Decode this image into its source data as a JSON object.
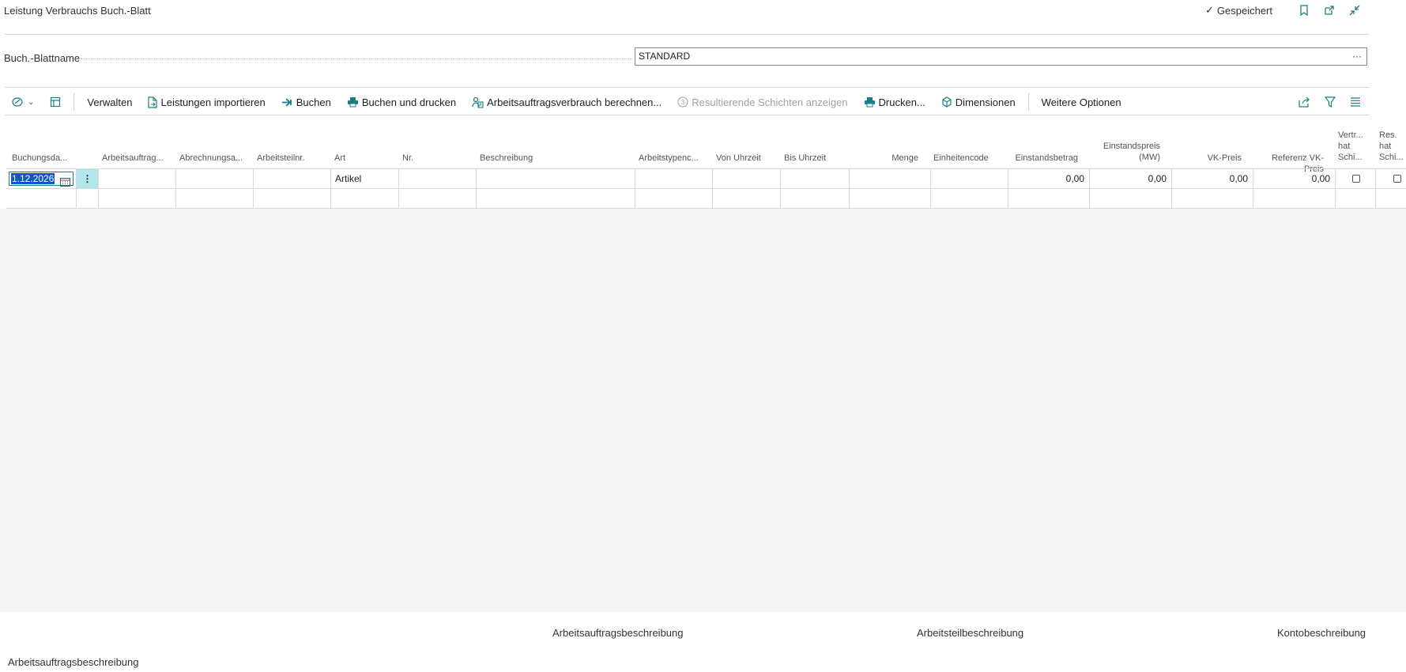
{
  "window": {
    "title": "Leistung Verbrauchs Buch.-Blatt",
    "saved_label": "Gespeichert"
  },
  "batch": {
    "label": "Buch.-Blattname",
    "value": "STANDARD",
    "more_label": "···"
  },
  "toolbar": {
    "manage": "Verwalten",
    "import": "Leistungen importieren",
    "post": "Buchen",
    "post_print": "Buchen und drucken",
    "calc": "Arbeitsauftragsverbrauch berechnen...",
    "show_layers": "Resultierende Schichten anzeigen",
    "print": "Drucken...",
    "dimensions": "Dimensionen",
    "more": "Weitere Optionen"
  },
  "columns": [
    {
      "label": "Buchungsda..."
    },
    {
      "label": "Arbeitsauftrag..."
    },
    {
      "label": "Abrechnungsa..."
    },
    {
      "label": "Arbeitsteilnr."
    },
    {
      "label": "Art"
    },
    {
      "label": "Nr."
    },
    {
      "label": "Beschreibung"
    },
    {
      "label": "Arbeitstypenc..."
    },
    {
      "label": "Von Uhrzeit"
    },
    {
      "label": "Bis Uhrzeit"
    },
    {
      "label": "Menge"
    },
    {
      "label": "Einheitencode"
    },
    {
      "label": "Einstandsbetrag"
    },
    {
      "label": "Einstandspreis (MW)",
      "line1": "Einstandspreis",
      "line2": "(MW)"
    },
    {
      "label": "VK-Preis"
    },
    {
      "label": "Referenz VK-Preis"
    },
    {
      "label": "Vertr... hat Schi...",
      "line1": "Vertr...",
      "line2": "hat",
      "line3": "Schi..."
    },
    {
      "label": "Res. hat Schi...",
      "line1": "Res.",
      "line2": "hat",
      "line3": "Schi..."
    }
  ],
  "row1": {
    "date": "1.12.2026",
    "art": "Artikel",
    "einstandsbetrag": "0,00",
    "einstandspreis": "0,00",
    "vk_preis": "0,00",
    "referenz_vk": "0,00",
    "vertr_checked": false,
    "res_checked": false
  },
  "footer": {
    "col1": "Arbeitsauftragsbeschreibung",
    "col2": "Arbeitsteilbeschreibung",
    "col3": "Kontobeschreibung",
    "bottom": "Arbeitsauftragsbeschreibung"
  },
  "colors": {
    "accent": "#1a7f86",
    "selection": "#b3e5ec",
    "gray_bg": "#f4f4f4"
  }
}
